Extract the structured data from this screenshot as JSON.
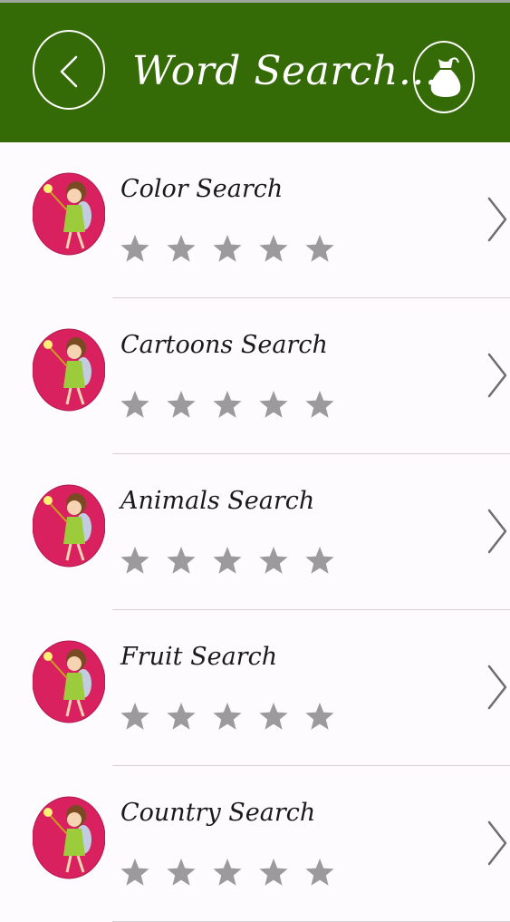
{
  "header": {
    "title": "Word Search...",
    "back_icon": "chevron-left-icon",
    "bag_icon": "money-bag-icon",
    "bar_color": "#356b06"
  },
  "categories": [
    {
      "label": "Color Search",
      "rating": 0,
      "max_rating": 5
    },
    {
      "label": "Cartoons Search",
      "rating": 0,
      "max_rating": 5
    },
    {
      "label": "Animals Search",
      "rating": 0,
      "max_rating": 5
    },
    {
      "label": "Fruit Search",
      "rating": 0,
      "max_rating": 5
    },
    {
      "label": "Country Search",
      "rating": 0,
      "max_rating": 5
    }
  ],
  "colors": {
    "star_empty": "#9c9a9c",
    "avatar_bg": "#d9215f",
    "chevron": "#6e6e6e"
  }
}
